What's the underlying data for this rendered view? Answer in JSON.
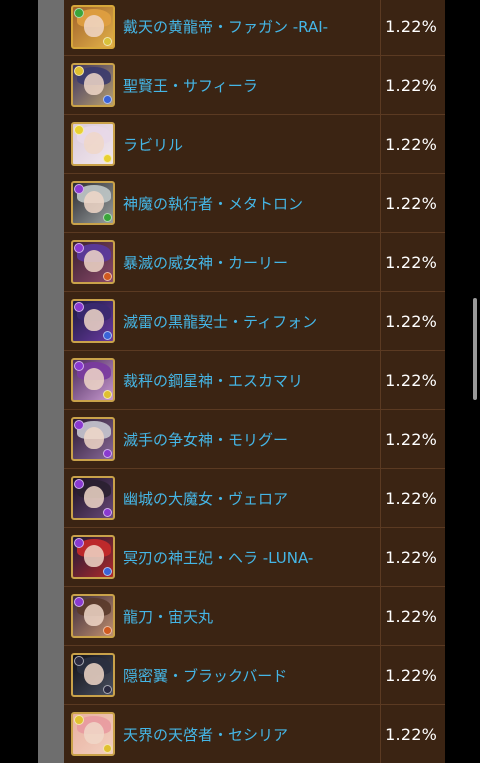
{
  "rows": [
    {
      "name": "戴天の黄龍帝・ファガン -RAI-",
      "percent": "1.22%",
      "icon": "fagan-rai-portrait-icon",
      "frame": "#d7a73a",
      "bg1": "#a0622a",
      "bg2": "#e3b24a",
      "hair": "#e0a040",
      "orb": "#3aa53a",
      "orb2": "#d9c23a"
    },
    {
      "name": "聖賢王・サフィーラ",
      "percent": "1.22%",
      "icon": "sapphira-portrait-icon",
      "frame": "#c9a24a",
      "bg1": "#3a3260",
      "bg2": "#b8a070",
      "hair": "#3b3b6e",
      "orb": "#e0c030",
      "orb2": "#3a63d8"
    },
    {
      "name": "ラビリル",
      "percent": "1.22%",
      "icon": "labyrille-portrait-icon",
      "frame": "#c9a24a",
      "bg1": "#d9c9d9",
      "bg2": "#f2e8ee",
      "hair": "#e8d8e8",
      "orb": "#e8d030",
      "orb2": "#e8d030"
    },
    {
      "name": "神魔の執行者・メタトロン",
      "percent": "1.22%",
      "icon": "metatron-portrait-icon",
      "frame": "#c9a24a",
      "bg1": "#2a2a30",
      "bg2": "#9aa0a0",
      "hair": "#c0c8c8",
      "orb": "#8a3ad0",
      "orb2": "#3aa53a"
    },
    {
      "name": "暴滅の威女神・カーリー",
      "percent": "1.22%",
      "icon": "kali-portrait-icon",
      "frame": "#c9a24a",
      "bg1": "#3a2030",
      "bg2": "#8a4a6a",
      "hair": "#5a3aa0",
      "orb": "#8a3ad0",
      "orb2": "#d05a20"
    },
    {
      "name": "滅雷の黒龍契士・ティフォン",
      "percent": "1.22%",
      "icon": "typhon-portrait-icon",
      "frame": "#c9a24a",
      "bg1": "#1a1a40",
      "bg2": "#6a3aa0",
      "hair": "#3a2a70",
      "orb": "#8a3ad0",
      "orb2": "#3a63d8"
    },
    {
      "name": "裁秤の鋼星神・エスカマリ",
      "percent": "1.22%",
      "icon": "escamael-portrait-icon",
      "frame": "#c9a24a",
      "bg1": "#4a2a5a",
      "bg2": "#c89ad0",
      "hair": "#7a3aa0",
      "orb": "#8a3ad0",
      "orb2": "#e0c030"
    },
    {
      "name": "滅手の争女神・モリグー",
      "percent": "1.22%",
      "icon": "morrigan-portrait-icon",
      "frame": "#c9a24a",
      "bg1": "#2a1a30",
      "bg2": "#8a6a9a",
      "hair": "#c8c8d0",
      "orb": "#8a3ad0",
      "orb2": "#8a3ad0"
    },
    {
      "name": "幽城の大魔女・ヴェロア",
      "percent": "1.22%",
      "icon": "veroah-portrait-icon",
      "frame": "#c9a24a",
      "bg1": "#1a1020",
      "bg2": "#6a4a7a",
      "hair": "#2a2030",
      "orb": "#8a3ad0",
      "orb2": "#8a3ad0"
    },
    {
      "name": "冥刃の神王妃・ヘラ -LUNA-",
      "percent": "1.22%",
      "icon": "hera-luna-portrait-icon",
      "frame": "#c9a24a",
      "bg1": "#1a1a3a",
      "bg2": "#b02a2a",
      "hair": "#c82a2a",
      "orb": "#8a3ad0",
      "orb2": "#3a63d8"
    },
    {
      "name": "龍刀・宙天丸",
      "percent": "1.22%",
      "icon": "chutenmaru-portrait-icon",
      "frame": "#c9a24a",
      "bg1": "#3a2a3a",
      "bg2": "#c09070",
      "hair": "#5a3a2a",
      "orb": "#8a3ad0",
      "orb2": "#d05a20"
    },
    {
      "name": "隠密翼・ブラックバード",
      "percent": "1.22%",
      "icon": "blackbird-portrait-icon",
      "frame": "#c9a24a",
      "bg1": "#101018",
      "bg2": "#4a5060",
      "hair": "#2a3040",
      "orb": "#2a2a40",
      "orb2": "#2a2a40"
    },
    {
      "name": "天界の天啓者・セシリア",
      "percent": "1.22%",
      "icon": "cecilia-portrait-icon",
      "frame": "#c9a24a",
      "bg1": "#e8b0a0",
      "bg2": "#f2d0c0",
      "hair": "#e89aa0",
      "orb": "#e0c030",
      "orb2": "#e0c030"
    }
  ]
}
